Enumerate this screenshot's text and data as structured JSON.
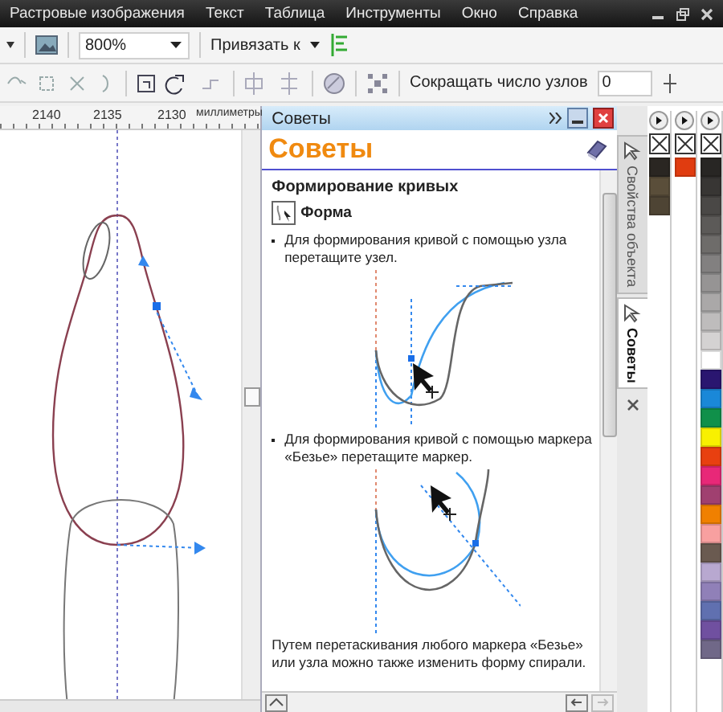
{
  "menu": [
    "Растровые изображения",
    "Текст",
    "Таблица",
    "Инструменты",
    "Окно",
    "Справка"
  ],
  "toolbar": {
    "zoom": "800%",
    "snap": "Привязать к"
  },
  "property_bar": {
    "reduce_label": "Сокращать число узлов",
    "reduce_value": "0"
  },
  "ruler": {
    "ticks": [
      "2140",
      "2135",
      "2130"
    ],
    "unit": "миллиметры"
  },
  "docker": {
    "title": "Советы",
    "heading": "Советы",
    "section": "Формирование кривых",
    "tool": "Форма",
    "tips": [
      {
        "kind": "node",
        "text": "Для формирования кривой с помощью узла перетащите узел."
      },
      {
        "kind": "bezier",
        "text": "Для формирования кривой с помощью маркера «Безье» перетащите маркер."
      }
    ],
    "footer": "Путем перетаскивания любого маркера «Безье» или узла можно также изменить форму спирали."
  },
  "docker_tabs": [
    {
      "label": "Свойства объекта",
      "selected": false
    },
    {
      "label": "Советы",
      "selected": true
    }
  ],
  "palettes": [
    {
      "swatches": [
        {
          "color": "#2a2622"
        },
        {
          "color": "#5a4e3a"
        },
        {
          "color": "#4e4434"
        }
      ]
    },
    {
      "swatches": [
        {
          "color": "#e03c10"
        }
      ]
    },
    {
      "swatches": [
        {
          "color": "#282624"
        },
        {
          "color": "#383634"
        },
        {
          "color": "#4a4846"
        },
        {
          "color": "#5c5a58"
        },
        {
          "color": "#6e6c6a"
        },
        {
          "color": "#828080"
        },
        {
          "color": "#969494"
        },
        {
          "color": "#aaa8a8"
        },
        {
          "color": "#bebcbc"
        },
        {
          "color": "#d4d2d2"
        },
        {
          "color": "#ffffff"
        },
        {
          "color": "#2a1670"
        },
        {
          "color": "#1a88d8"
        },
        {
          "color": "#10904a"
        },
        {
          "color": "#f8f000"
        },
        {
          "color": "#e84010"
        },
        {
          "color": "#e82878"
        },
        {
          "color": "#a04070"
        },
        {
          "color": "#f08000"
        },
        {
          "color": "#f8a0a0"
        },
        {
          "color": "#6a5a50"
        },
        {
          "color": "#b8a8d0"
        },
        {
          "color": "#9080b8"
        },
        {
          "color": "#6070b0"
        },
        {
          "color": "#7050a0"
        },
        {
          "color": "#706888"
        }
      ]
    }
  ]
}
